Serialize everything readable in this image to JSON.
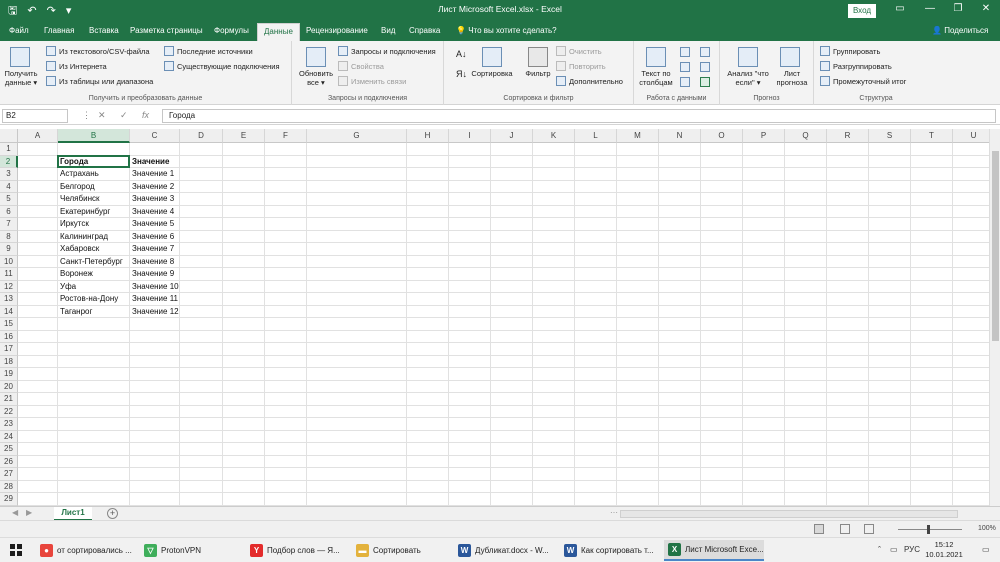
{
  "window": {
    "title": "Лист Microsoft Excel.xlsx  -  Excel",
    "signin": "Вход",
    "quick_access": [
      "🖫",
      "↶",
      "↷",
      "▾"
    ],
    "controls": [
      "▭",
      "—",
      "❐",
      "✕"
    ]
  },
  "menu": {
    "tabs": [
      "Файл",
      "Главная",
      "Вставка",
      "Разметка страницы",
      "Формулы",
      "Данные",
      "Рецензирование",
      "Вид",
      "Справка"
    ],
    "active_tab": "Данные",
    "tell_me": "Что вы хотите сделать?",
    "share": "Поделиться"
  },
  "ribbon": {
    "get_data": {
      "big_button": [
        "Получить",
        "данные ▾"
      ],
      "items": [
        "Из текстового/CSV-файла",
        "Из Интернета",
        "Из таблицы или диапазона",
        "Последние источники",
        "Существующие подключения"
      ],
      "label": "Получить и преобразовать данные"
    },
    "queries": {
      "big_button": [
        "Обновить",
        "все ▾"
      ],
      "items": [
        "Запросы и подключения",
        "Свойства",
        "Изменить связи"
      ],
      "label": "Запросы и подключения"
    },
    "sort_filter": {
      "sort": "Сортировка",
      "filter": "Фильтр",
      "items": [
        "Очистить",
        "Повторить",
        "Дополнительно"
      ],
      "label": "Сортировка и фильтр"
    },
    "data_tools": {
      "big_button": [
        "Текст по",
        "столбцам"
      ],
      "label": "Работа с данными"
    },
    "forecast": {
      "whatif": [
        "Анализ \"что",
        "если\" ▾"
      ],
      "sheet": [
        "Лист",
        "прогноза"
      ],
      "label": "Прогноз"
    },
    "outline": {
      "items": [
        "Группировать",
        "Разгруппировать",
        "Промежуточный итог"
      ],
      "label": "Структура"
    }
  },
  "formula_bar": {
    "name_box": "B2",
    "icons": [
      "⋮",
      "✕",
      "✓",
      "fx"
    ],
    "content": "Города"
  },
  "sheet": {
    "columns": [
      "A",
      "B",
      "C",
      "D",
      "E",
      "F",
      "G",
      "H",
      "I",
      "J",
      "K",
      "L",
      "M",
      "N",
      "O",
      "P",
      "Q",
      "R",
      "S",
      "T",
      "U"
    ],
    "row_count": 29,
    "selected_cell": "B2",
    "table": {
      "header": [
        "Города",
        "Значение"
      ],
      "rows": [
        [
          "Астрахань",
          "Значение 1"
        ],
        [
          "Белгород",
          "Значение 2"
        ],
        [
          "Челябинск",
          "Значение 3"
        ],
        [
          "Екатеринбург",
          "Значение 4"
        ],
        [
          "Иркутск",
          "Значение 5"
        ],
        [
          "Калининград",
          "Значение 6"
        ],
        [
          "Хабаровск",
          "Значение 7"
        ],
        [
          "Санкт-Петербург",
          "Значение 8"
        ],
        [
          "Воронеж",
          "Значение 9"
        ],
        [
          "Уфа",
          "Значение 10"
        ],
        [
          "Ростов-на-Дону",
          "Значение 11"
        ],
        [
          "Таганрог",
          "Значение 12"
        ]
      ]
    }
  },
  "sheet_tabs": {
    "tabs": [
      "Лист1"
    ],
    "add": "+",
    "nav": [
      "◀",
      "▶",
      "⋯"
    ]
  },
  "status": {
    "zoom": "100%"
  },
  "taskbar": {
    "apps": [
      {
        "label": "от сортировались ...",
        "icon": "chrome-icon",
        "color": "#e8453c",
        "glyph": "●"
      },
      {
        "label": "ProtonVPN",
        "icon": "protonvpn-icon",
        "color": "#3fae5b",
        "glyph": "▽"
      },
      {
        "label": "Подбор слов — Я...",
        "icon": "yandex-browser-icon",
        "color": "#e32b2b",
        "glyph": "Y"
      },
      {
        "label": "Сортировать",
        "icon": "folder-icon",
        "color": "#e3b23c",
        "glyph": "▬"
      },
      {
        "label": "Дубликат.docx - W...",
        "icon": "word-icon",
        "color": "#2b579a",
        "glyph": "W"
      },
      {
        "label": "Как сортировать т...",
        "icon": "word-icon",
        "color": "#2b579a",
        "glyph": "W"
      },
      {
        "label": "Лист Microsoft Exce...",
        "icon": "excel-icon",
        "color": "#217346",
        "glyph": "X"
      }
    ],
    "tray": {
      "arrow": "ˆ",
      "language": "РУС",
      "time": "15:12",
      "date": "10.01.2021",
      "notify": "▭"
    }
  }
}
